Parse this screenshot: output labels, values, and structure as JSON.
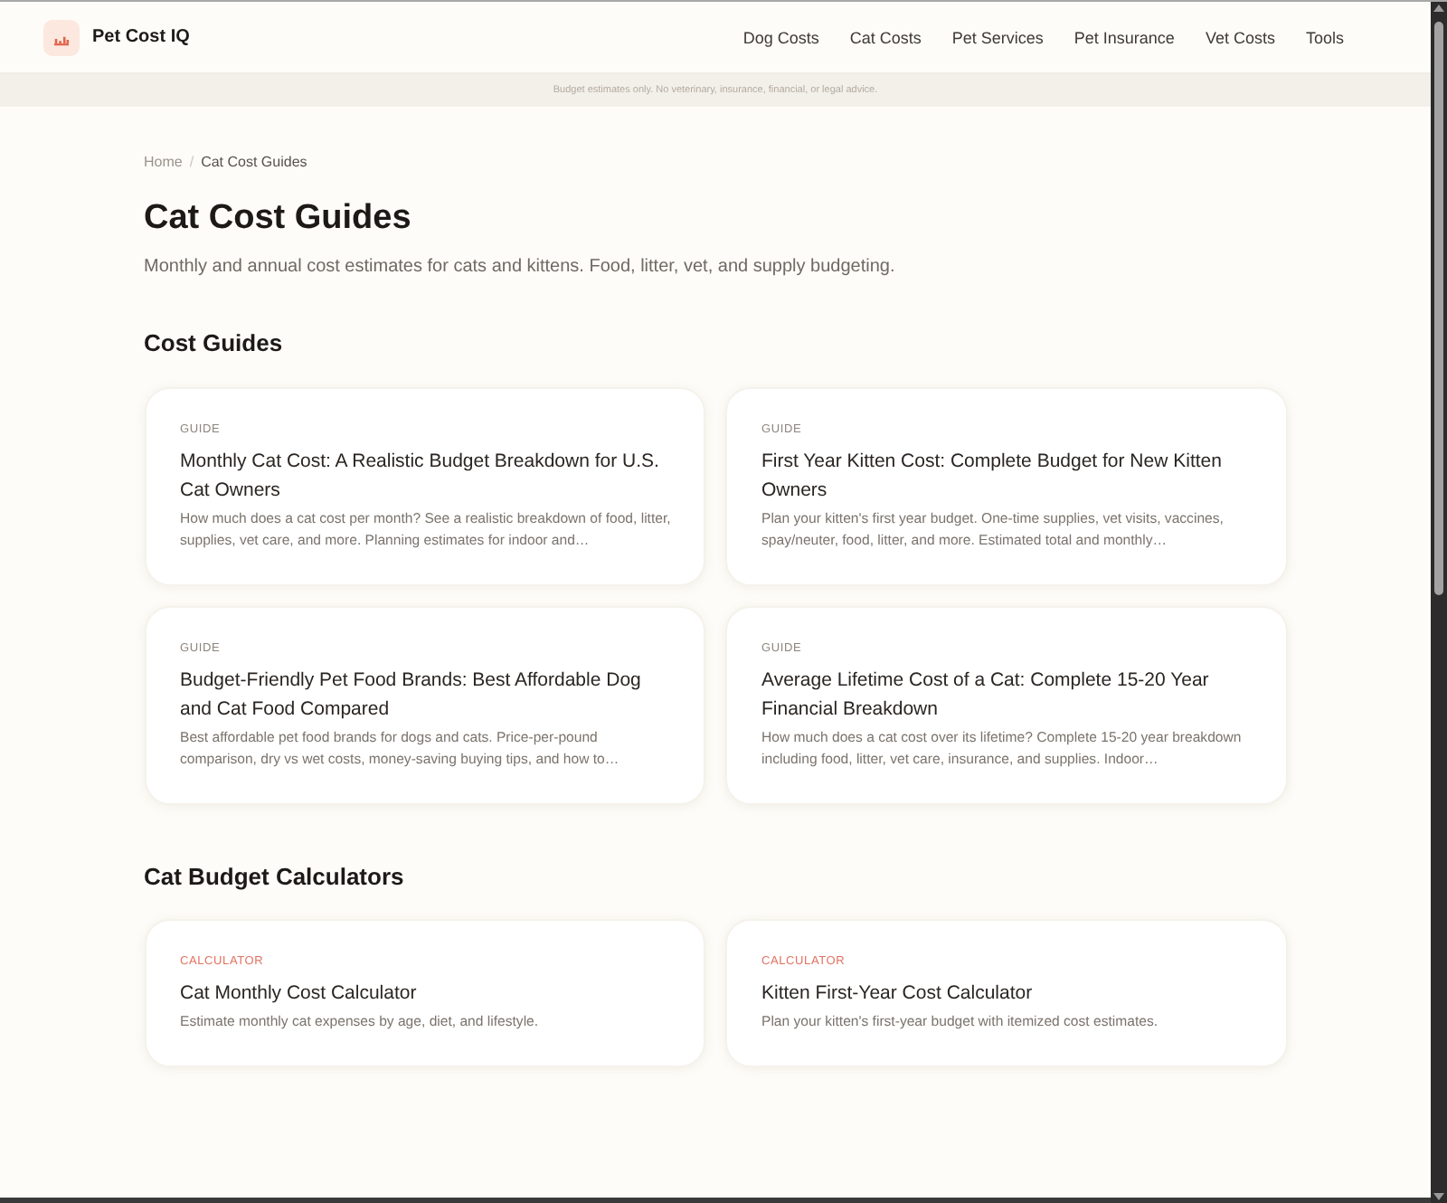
{
  "header": {
    "brand": "Pet Cost IQ",
    "nav": [
      "Dog Costs",
      "Cat Costs",
      "Pet Services",
      "Pet Insurance",
      "Vet Costs",
      "Tools"
    ]
  },
  "disclaimer": "Budget estimates only. No veterinary, insurance, financial, or legal advice.",
  "breadcrumb": {
    "separator": "/",
    "items": [
      {
        "label": "Home",
        "current": false
      },
      {
        "label": "Cat Cost Guides",
        "current": true
      }
    ]
  },
  "page": {
    "title": "Cat Cost Guides",
    "subtitle": "Monthly and annual cost estimates for cats and kittens. Food, litter, vet, and supply budgeting."
  },
  "sections": [
    {
      "heading": "Cost Guides",
      "cards": [
        {
          "kind": "guide",
          "tag": "GUIDE",
          "title": "Monthly Cat Cost: A Realistic Budget Breakdown for U.S. Cat Owners",
          "description": "How much does a cat cost per month? See a realistic breakdown of food, litter, supplies, vet care, and more. Planning estimates for indoor and…"
        },
        {
          "kind": "guide",
          "tag": "GUIDE",
          "title": "First Year Kitten Cost: Complete Budget for New Kitten Owners",
          "description": "Plan your kitten's first year budget. One-time supplies, vet visits, vaccines, spay/neuter, food, litter, and more. Estimated total and monthly…"
        },
        {
          "kind": "guide",
          "tag": "GUIDE",
          "title": "Budget-Friendly Pet Food Brands: Best Affordable Dog and Cat Food Compared",
          "description": "Best affordable pet food brands for dogs and cats. Price-per-pound comparison, dry vs wet costs, money-saving buying tips, and how to…"
        },
        {
          "kind": "guide",
          "tag": "GUIDE",
          "title": "Average Lifetime Cost of a Cat: Complete 15-20 Year Financial Breakdown",
          "description": "How much does a cat cost over its lifetime? Complete 15-20 year breakdown including food, litter, vet care, insurance, and supplies. Indoor…"
        }
      ]
    },
    {
      "heading": "Cat Budget Calculators",
      "cards": [
        {
          "kind": "calculator",
          "tag": "CALCULATOR",
          "title": "Cat Monthly Cost Calculator",
          "description": "Estimate monthly cat expenses by age, diet, and lifestyle."
        },
        {
          "kind": "calculator",
          "tag": "CALCULATOR",
          "title": "Kitten First-Year Cost Calculator",
          "description": "Plan your kitten's first-year budget with itemized cost estimates."
        }
      ]
    }
  ]
}
